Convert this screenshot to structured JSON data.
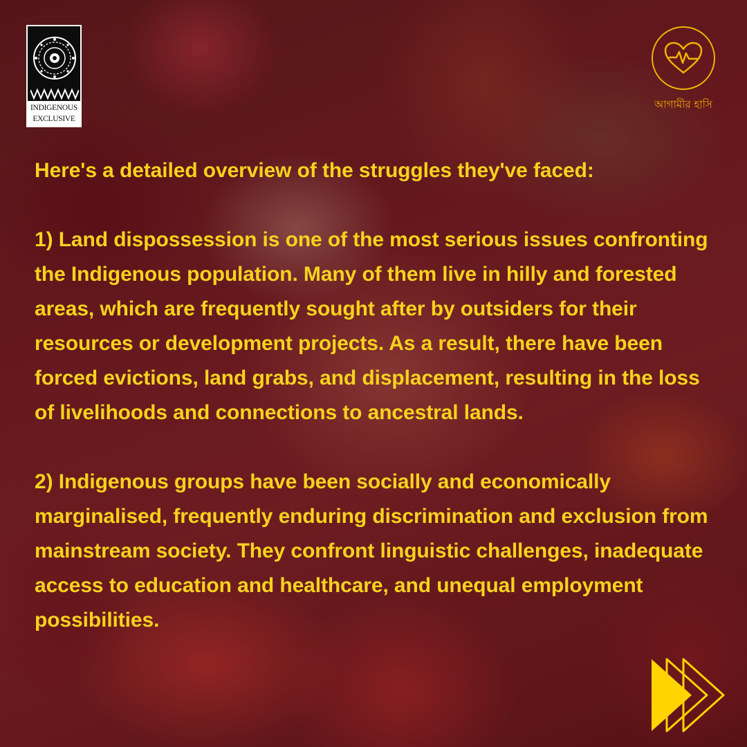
{
  "logo": {
    "line1": "INDIGENOUS",
    "line2": "EXCLUSIVE",
    "icon": "tribal-pattern-icon"
  },
  "brand": {
    "name": "আগামীর হাসি",
    "icon": "heart-pulse-icon",
    "color": "#f2b400"
  },
  "post": {
    "intro": "Here's a detailed overview of the struggles they've faced:",
    "points": [
      "1) Land dispossession is one of the most serious issues confronting the Indigenous population. Many of them live in hilly and forested areas, which are frequently sought after by outsiders for their resources or development projects. As a result, there have been forced evictions, land grabs, and displacement, resulting in the loss of livelihoods and connections to ancestral lands.",
      "2) Indigenous groups have been socially and economically marginalised, frequently enduring discrimination and exclusion from mainstream society. They confront linguistic challenges, inadequate access to education and healthcare, and unequal employment possibilities."
    ]
  },
  "next_icon": "fast-forward-arrows-icon",
  "colors": {
    "text": "#f7d21d",
    "accent": "#f2b400",
    "arrow": "#ffd400"
  }
}
